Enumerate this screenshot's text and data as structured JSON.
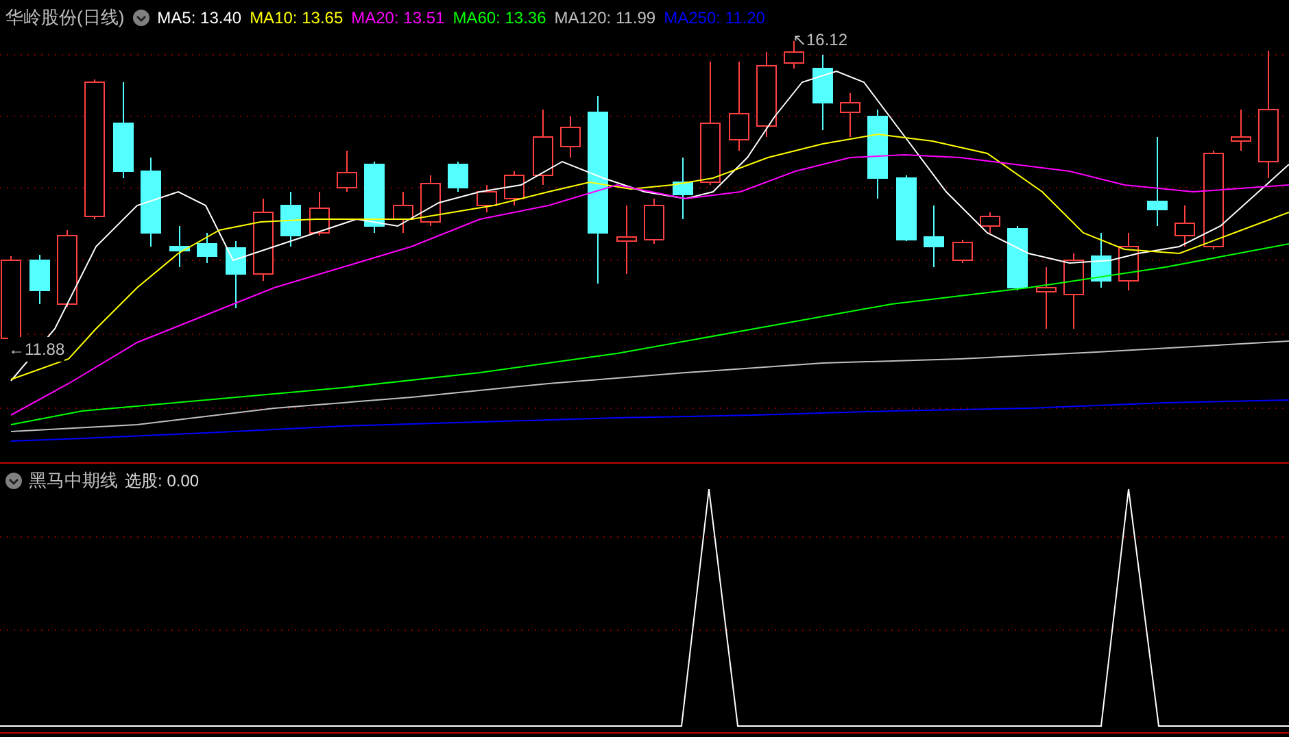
{
  "main_chart": {
    "title": "华岭股份(日线)",
    "moving_averages": [
      {
        "label": "MA5:",
        "value": "13.40",
        "color": "#ffffff"
      },
      {
        "label": "MA10:",
        "value": "13.65",
        "color": "#ffff00"
      },
      {
        "label": "MA20:",
        "value": "13.51",
        "color": "#ff00ff"
      },
      {
        "label": "MA60:",
        "value": "13.36",
        "color": "#00ff00"
      },
      {
        "label": "MA120:",
        "value": "11.99",
        "color": "#c0c0c0"
      },
      {
        "label": "MA250:",
        "value": "11.20",
        "color": "#0000ff"
      }
    ],
    "high_marker": "↖16.12",
    "low_marker": "←11.88"
  },
  "indicator": {
    "name": "黑马中期线",
    "label": "选股:",
    "value": "0.00"
  }
}
